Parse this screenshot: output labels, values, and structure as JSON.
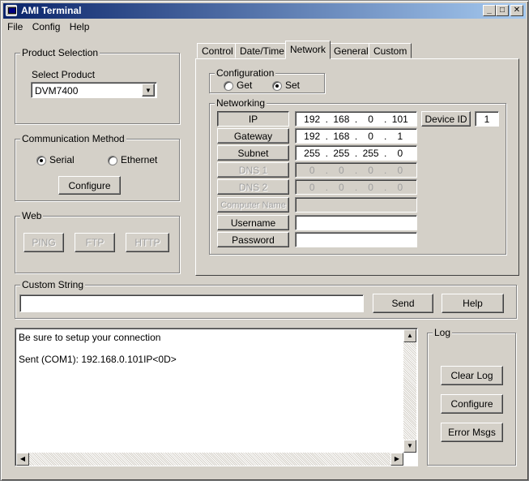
{
  "window": {
    "title": "AMI Terminal"
  },
  "menu": [
    "File",
    "Config",
    "Help"
  ],
  "product_selection": {
    "group_label": "Product Selection",
    "select_label": "Select Product",
    "selected": "DVM7400"
  },
  "communication": {
    "group_label": "Communication Method",
    "serial_label": "Serial",
    "ethernet_label": "Ethernet",
    "configure_label": "Configure"
  },
  "web": {
    "group_label": "Web",
    "ping_label": "PING",
    "ftp_label": "FTP",
    "http_label": "HTTP"
  },
  "tabs": [
    "Control",
    "Date/Time",
    "Network",
    "General",
    "Custom"
  ],
  "configuration": {
    "group_label": "Configuration",
    "get_label": "Get",
    "set_label": "Set"
  },
  "networking": {
    "group_label": "Networking",
    "ip_label": "IP",
    "ip": [
      "192",
      "168",
      "0",
      "101"
    ],
    "gateway_label": "Gateway",
    "gateway": [
      "192",
      "168",
      "0",
      "1"
    ],
    "subnet_label": "Subnet",
    "subnet": [
      "255",
      "255",
      "255",
      "0"
    ],
    "dns1_label": "DNS 1",
    "dns1": [
      "0",
      "0",
      "0",
      "0"
    ],
    "dns2_label": "DNS 2",
    "dns2": [
      "0",
      "0",
      "0",
      "0"
    ],
    "computer_name_label": "Computer Name",
    "username_label": "Username",
    "password_label": "Password",
    "device_id_label": "Device ID",
    "device_id": "1"
  },
  "custom_string": {
    "group_label": "Custom String",
    "value": "",
    "send_label": "Send",
    "help_label": "Help"
  },
  "log_output": {
    "line1": "Be sure to setup your connection",
    "line2": "Sent (COM1):  192.168.0.101IP<0D>"
  },
  "log": {
    "group_label": "Log",
    "clear_label": "Clear Log",
    "configure_label": "Configure",
    "error_label": "Error Msgs"
  },
  "window_buttons": {
    "minimize": "_",
    "maximize": "□",
    "close": "✕"
  }
}
